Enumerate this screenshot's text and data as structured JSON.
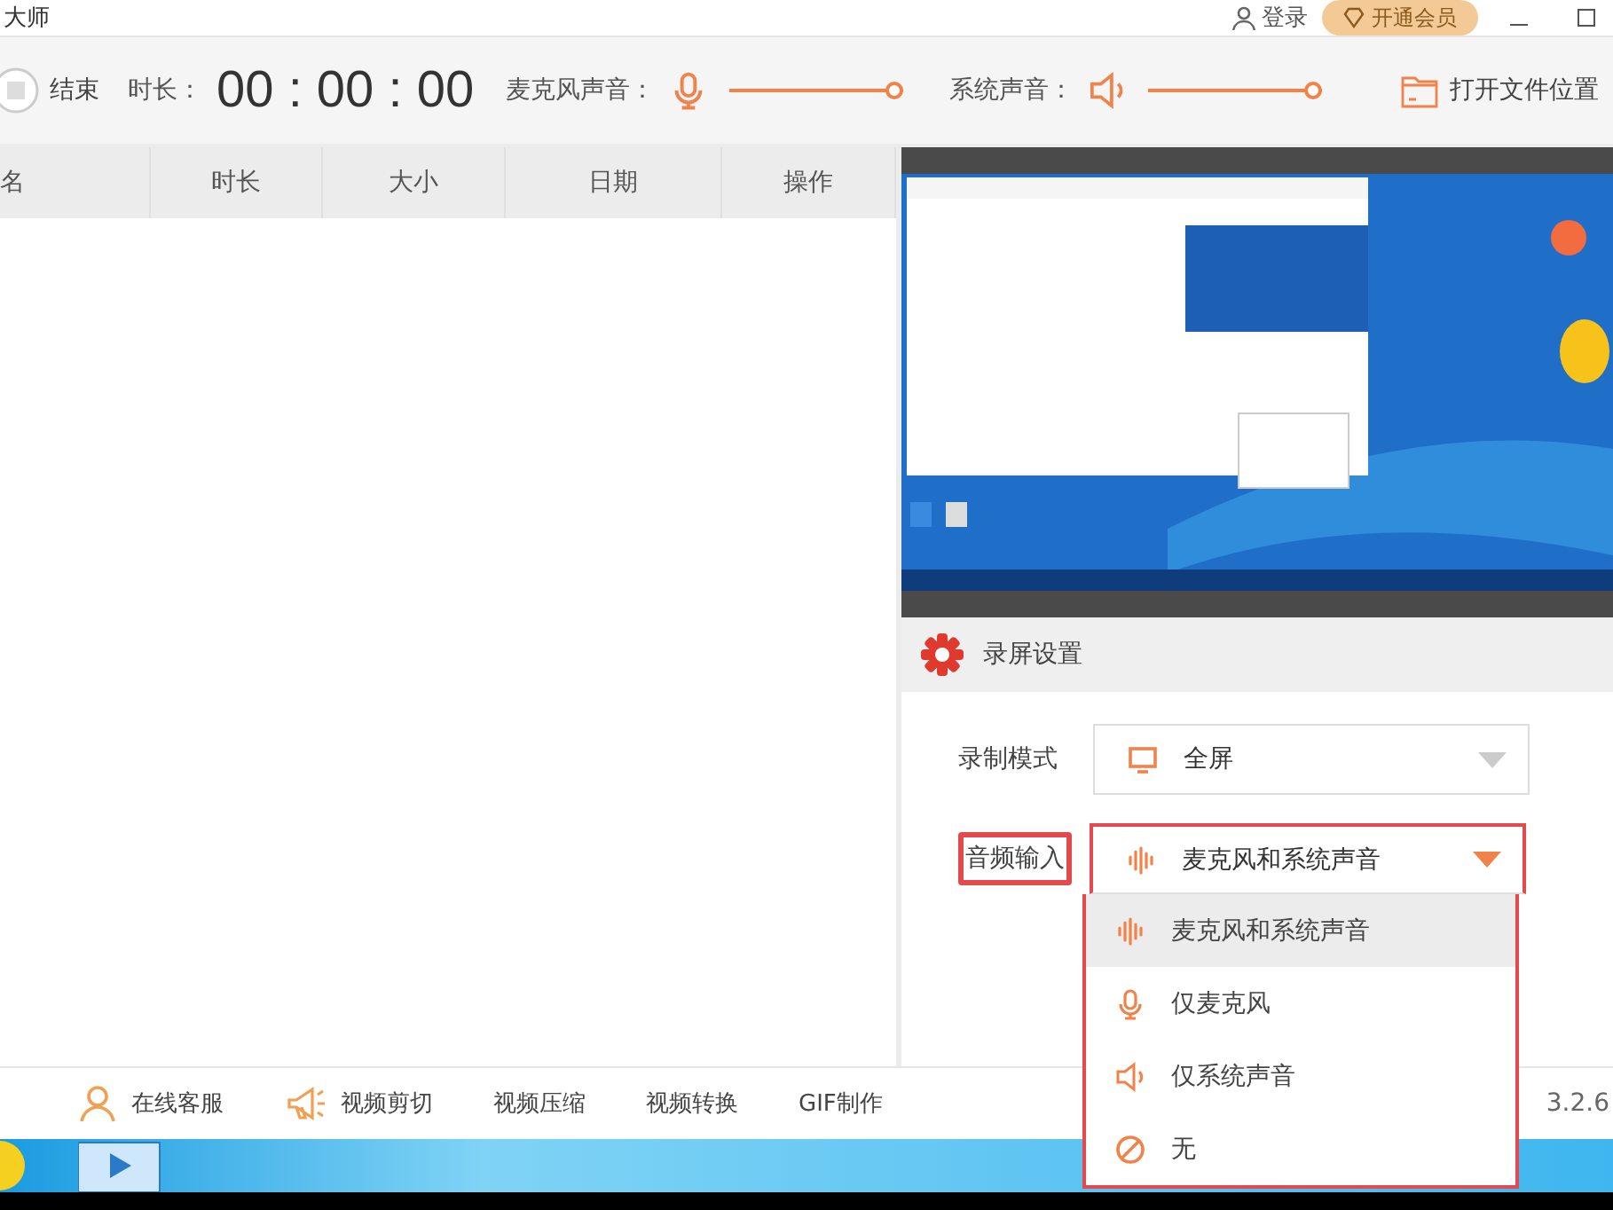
{
  "title_bar": {
    "title": "大师",
    "login": "登录",
    "vip_button": "开通会员"
  },
  "toolbar": {
    "stop": "结束",
    "duration_label": "时长：",
    "timer": "00 : 00 : 00",
    "mic": {
      "label": "麦克风声音：",
      "level": 1
    },
    "system": {
      "label": "系统声音：",
      "level": 1
    },
    "open_folder": "打开文件位置"
  },
  "table": {
    "columns": [
      "名",
      "时长",
      "大小",
      "日期",
      "操作"
    ]
  },
  "settings": {
    "title": "录屏设置",
    "fields": [
      {
        "label": "录制模式",
        "value": "全屏",
        "kind": "monitor",
        "highlighted": false,
        "open": false
      },
      {
        "label": "音频输入",
        "value": "麦克风和系统声音",
        "kind": "wave",
        "highlighted": true,
        "open": true
      }
    ]
  },
  "dropdown": {
    "options": [
      {
        "label": "麦克风和系统声音",
        "kind": "wave",
        "selected": true
      },
      {
        "label": "仅麦克风",
        "kind": "mic",
        "selected": false
      },
      {
        "label": "仅系统声音",
        "kind": "speaker",
        "selected": false
      },
      {
        "label": "无",
        "kind": "none",
        "selected": false
      }
    ]
  },
  "bottom_bar": {
    "items": [
      {
        "label": "在线客服",
        "kind": "user"
      },
      {
        "label": "视频剪切",
        "kind": "megaphone"
      },
      {
        "label": "视频压缩"
      },
      {
        "label": "视频转换"
      },
      {
        "label": "GIF制作"
      }
    ],
    "version": "3.2.6"
  }
}
